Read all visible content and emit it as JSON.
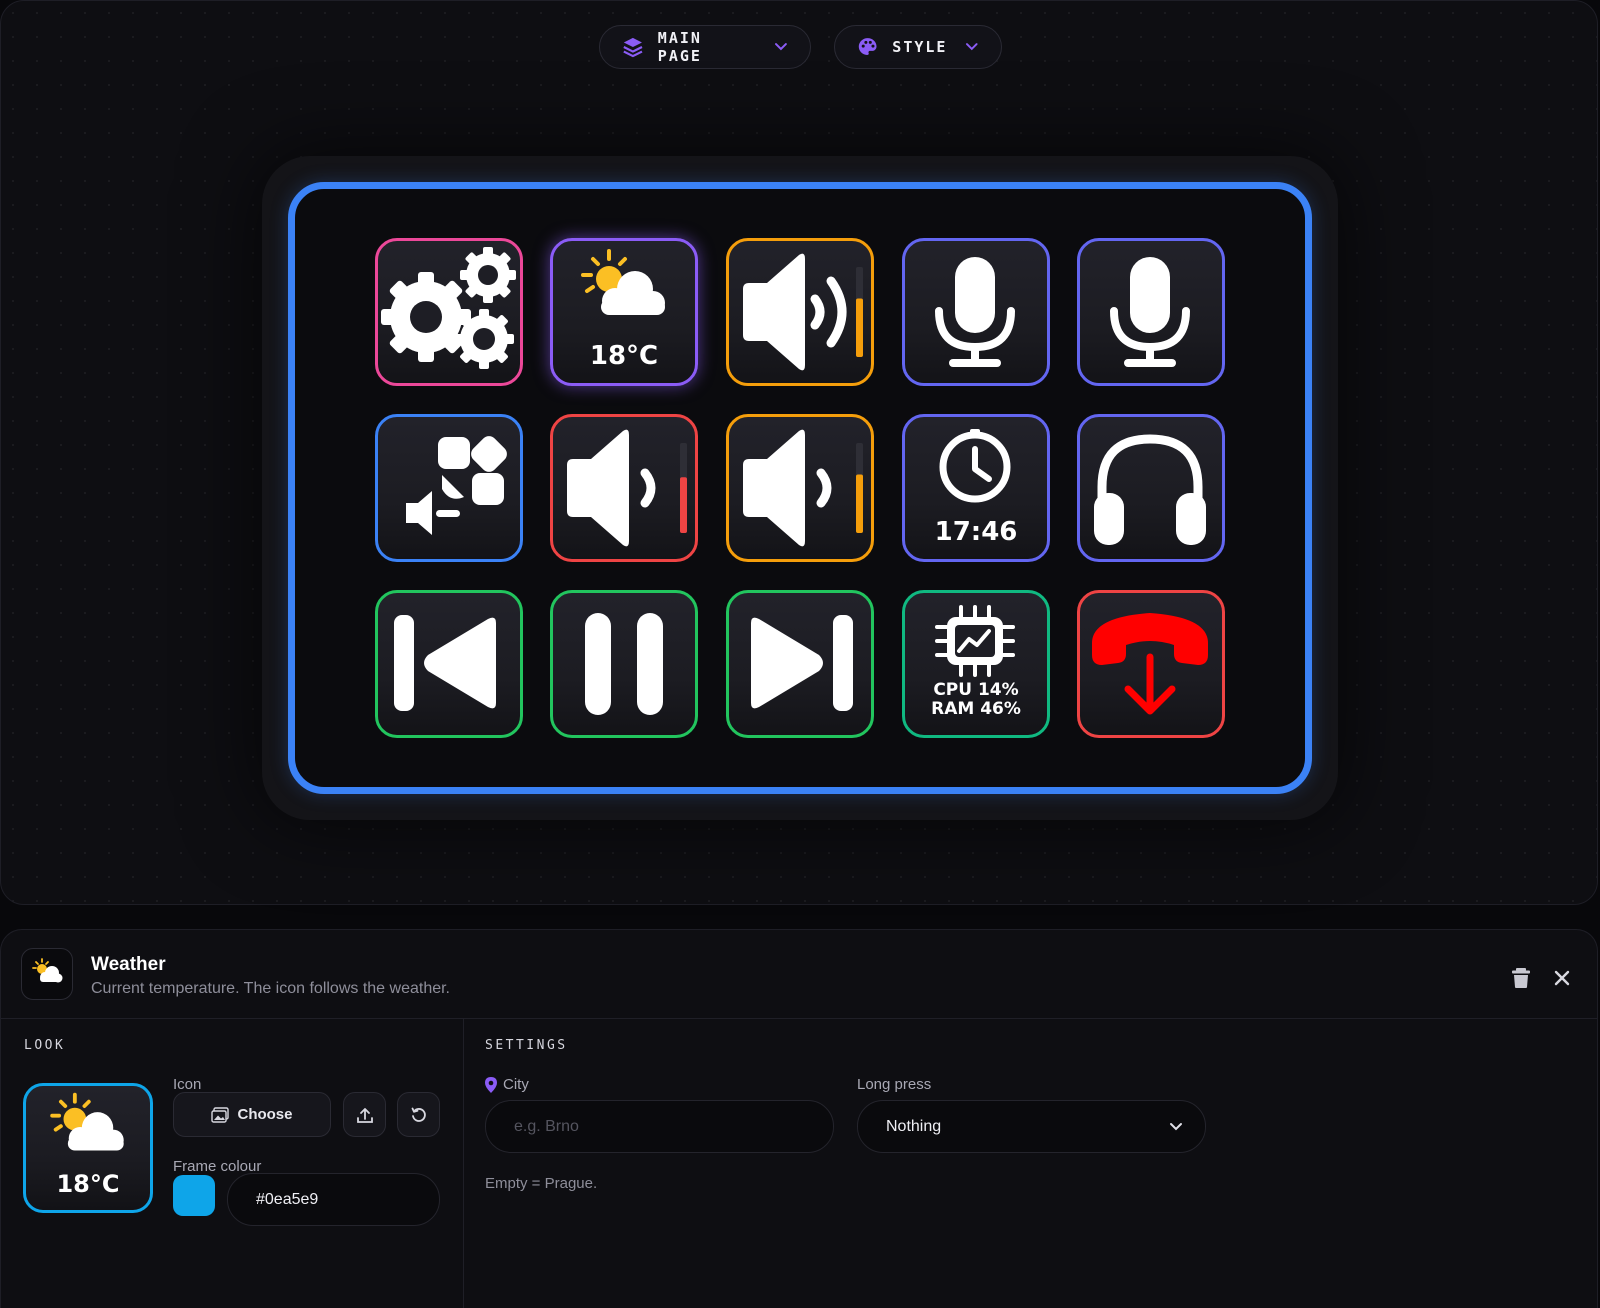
{
  "toolbar": {
    "page_selector": {
      "label": "MAIN PAGE",
      "icon": "layers-icon",
      "accent": "#8b5cf6"
    },
    "style_selector": {
      "label": "STYLE",
      "icon": "palette-icon",
      "accent": "#8b5cf6"
    }
  },
  "device": {
    "frame_color": "#3b82f6",
    "keys": [
      {
        "name": "settings",
        "icon": "gears-icon",
        "color": "#ec4899"
      },
      {
        "name": "weather",
        "icon": "weather-partly-cloudy-icon",
        "color": "#8b5cf6",
        "label": "18°C",
        "selected": true
      },
      {
        "name": "volume-output",
        "icon": "speaker-loud-icon",
        "color": "#f59e0b",
        "level": 0.65
      },
      {
        "name": "mic-1",
        "icon": "microphone-icon",
        "color": "#6366f1"
      },
      {
        "name": "mic-2",
        "icon": "microphone-icon",
        "color": "#6366f1"
      },
      {
        "name": "app-volume",
        "icon": "app-volume-icon",
        "color": "#3b82f6"
      },
      {
        "name": "volume-red",
        "icon": "speaker-icon",
        "color": "#ef4444",
        "level": 0.62
      },
      {
        "name": "volume-orange",
        "icon": "speaker-icon",
        "color": "#f59e0b",
        "level": 0.65
      },
      {
        "name": "clock",
        "icon": "clock-icon",
        "color": "#6366f1",
        "label": "17:46"
      },
      {
        "name": "headphones",
        "icon": "headphones-icon",
        "color": "#6366f1"
      },
      {
        "name": "previous-track",
        "icon": "previous-track-icon",
        "color": "#22c55e"
      },
      {
        "name": "play-pause",
        "icon": "pause-icon",
        "color": "#22c55e"
      },
      {
        "name": "next-track",
        "icon": "next-track-icon",
        "color": "#22c55e"
      },
      {
        "name": "system-monitor",
        "icon": "cpu-chip-icon",
        "color": "#10b981",
        "line1": "CPU 14%",
        "line2": "RAM 46%"
      },
      {
        "name": "hang-up",
        "icon": "hang-up-phone-icon",
        "color": "#ef4444",
        "icon_color": "#ff0000"
      }
    ]
  },
  "editor": {
    "title": "Weather",
    "subtitle": "Current temperature. The icon follows the weather.",
    "look": {
      "section_label": "LOOK",
      "preview_label": "18°C",
      "icon_label": "Icon",
      "choose_label": "Choose",
      "frame_colour_label": "Frame colour",
      "frame_colour_value": "#0ea5e9"
    },
    "settings": {
      "section_label": "SETTINGS",
      "city_label": "City",
      "city_placeholder": "e.g. Brno",
      "city_hint": "Empty = Prague.",
      "long_press_label": "Long press",
      "long_press_value": "Nothing"
    }
  }
}
